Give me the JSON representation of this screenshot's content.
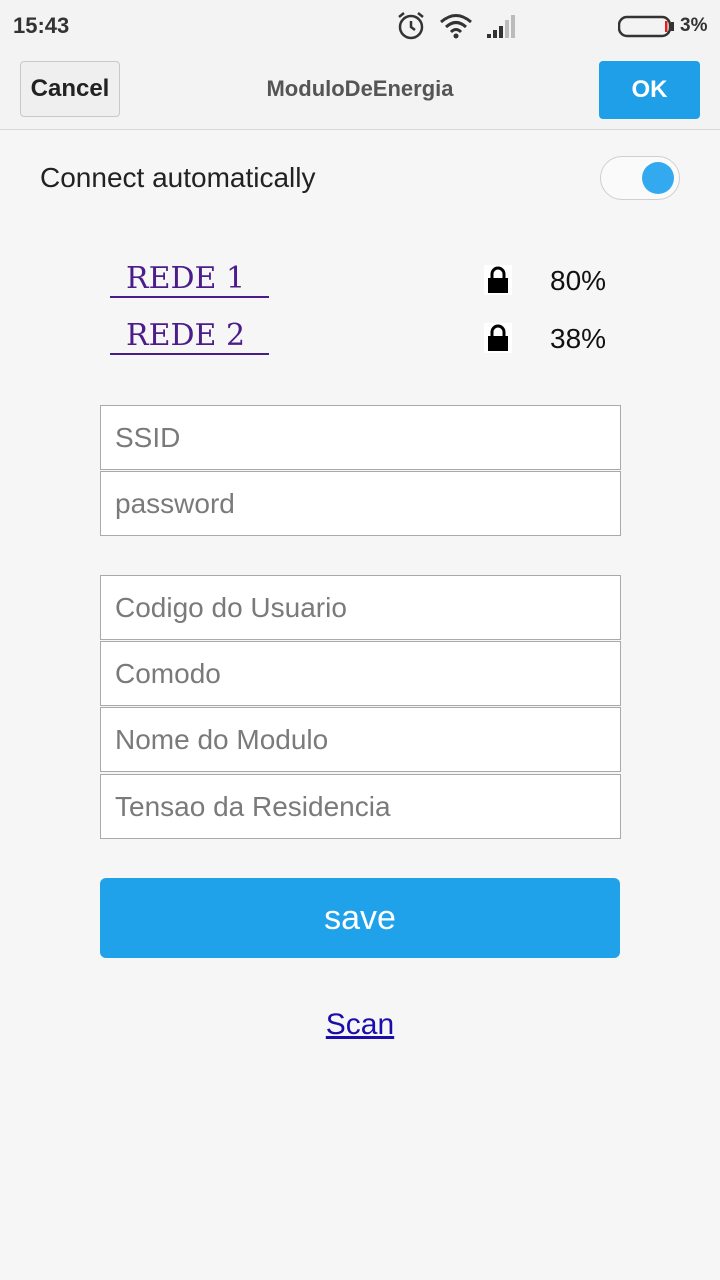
{
  "status": {
    "time": "15:43",
    "battery_percent": "3%",
    "icons": [
      "alarm-icon",
      "wifi-icon",
      "cell-signal-icon",
      "battery-icon"
    ]
  },
  "header": {
    "cancel_label": "Cancel",
    "title": "ModuloDeEnergia",
    "ok_label": "OK"
  },
  "connect": {
    "label": "Connect automatically",
    "enabled": true
  },
  "networks": [
    {
      "name": "REDE 1",
      "signal": "80%",
      "secured": true
    },
    {
      "name": "REDE 2",
      "signal": "38%",
      "secured": true
    }
  ],
  "form": {
    "ssid_placeholder": "SSID",
    "password_placeholder": "password",
    "user_code_placeholder": "Codigo do Usuario",
    "room_placeholder": "Comodo",
    "module_name_placeholder": "Nome do Modulo",
    "voltage_placeholder": "Tensao da Residencia",
    "save_label": "save"
  },
  "scan_label": "Scan",
  "colors": {
    "accent": "#1f9fe8",
    "network_text": "#4b1d8a",
    "link": "#1a0dab"
  }
}
